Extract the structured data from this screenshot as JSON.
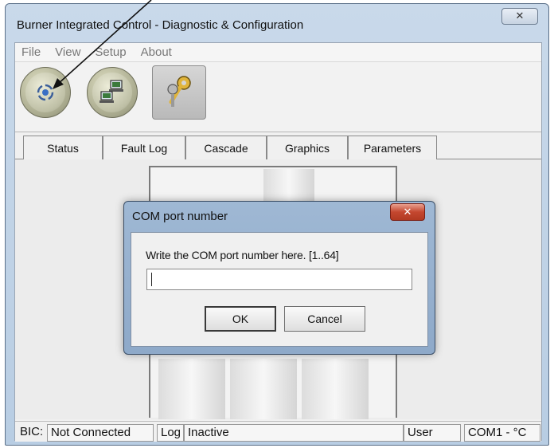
{
  "window": {
    "title": "Burner Integrated Control - Diagnostic & Configuration",
    "close_glyph": "✕"
  },
  "menu": [
    "File",
    "View",
    "Setup",
    "About"
  ],
  "toolbar": {
    "buttons": [
      {
        "name": "connect-button",
        "icon": "connection-icon"
      },
      {
        "name": "network-button",
        "icon": "computers-icon"
      },
      {
        "name": "keys-button",
        "icon": "keys-icon"
      }
    ]
  },
  "tabs": [
    "Status",
    "Fault Log",
    "Cascade",
    "Graphics",
    "Parameters"
  ],
  "statusbar": {
    "bic_label": "BIC:",
    "connection": "Not Connected",
    "log_label": "Log",
    "log_state": "Inactive",
    "user": "User",
    "port_units": "COM1 - °C"
  },
  "dialog": {
    "title": "COM port number",
    "close_glyph": "✕",
    "prompt": "Write the COM port number here. [1..64]",
    "input_value": "",
    "ok_label": "OK",
    "cancel_label": "Cancel"
  },
  "colors": {
    "title_bar": "#b8cde3",
    "dialog_close": "#c4472f",
    "toolbar_button": "#a7a88c"
  }
}
